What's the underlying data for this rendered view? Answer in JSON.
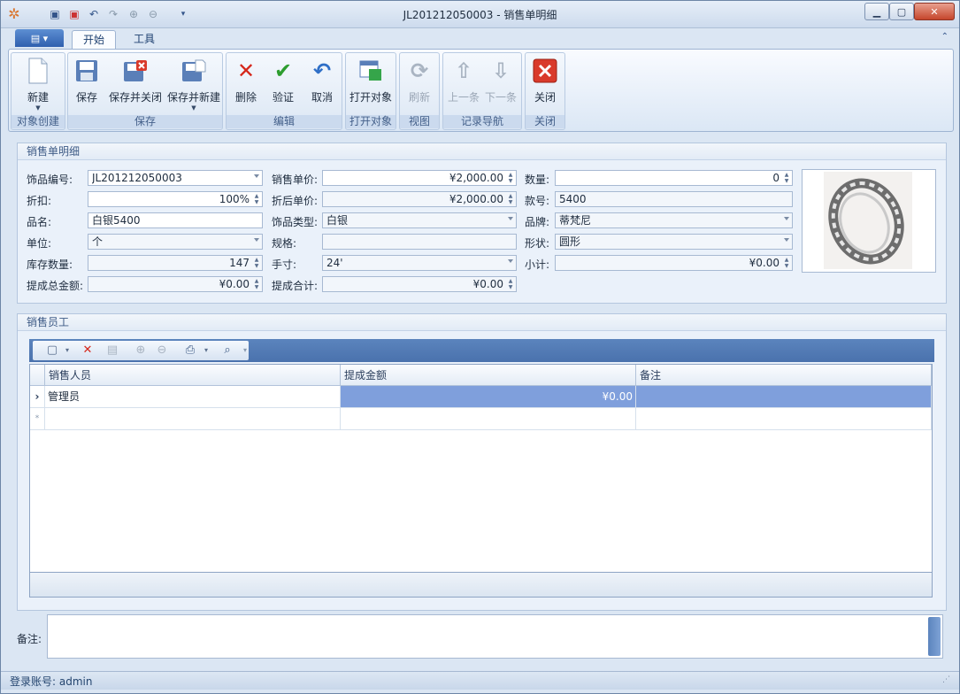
{
  "window": {
    "title": "JL201212050003 - 销售单明细",
    "buttons": {
      "minimize": "▁",
      "maximize": "▢",
      "close": "✕"
    }
  },
  "ribbon": {
    "collapse_glyph": "⌃",
    "tabs": [
      {
        "label": "开始"
      },
      {
        "label": "工具"
      }
    ],
    "groups": [
      {
        "label": "对象创建",
        "buttons": [
          {
            "label": "新建",
            "icon": "new-document-icon"
          }
        ]
      },
      {
        "label": "保存",
        "buttons": [
          {
            "label": "保存",
            "icon": "save-icon"
          },
          {
            "label": "保存并关闭",
            "icon": "save-close-icon"
          },
          {
            "label": "保存并新建",
            "icon": "save-new-icon"
          }
        ]
      },
      {
        "label": "编辑",
        "buttons": [
          {
            "label": "删除",
            "icon": "delete-icon"
          },
          {
            "label": "验证",
            "icon": "validate-check-icon"
          },
          {
            "label": "取消",
            "icon": "undo-icon"
          }
        ]
      },
      {
        "label": "打开对象",
        "buttons": [
          {
            "label": "打开对象",
            "icon": "open-object-icon"
          }
        ]
      },
      {
        "label": "视图",
        "buttons": [
          {
            "label": "刷新",
            "icon": "refresh-icon"
          }
        ]
      },
      {
        "label": "记录导航",
        "buttons": [
          {
            "label": "上一条",
            "icon": "arrow-up-icon"
          },
          {
            "label": "下一条",
            "icon": "arrow-down-icon"
          }
        ]
      },
      {
        "label": "关闭",
        "buttons": [
          {
            "label": "关闭",
            "icon": "close-red-icon"
          }
        ]
      }
    ]
  },
  "detail": {
    "section_title": "销售单明细",
    "fields": {
      "item_code": {
        "label": "饰品编号:",
        "value": "JL201212050003"
      },
      "discount": {
        "label": "折扣:",
        "value": "100%"
      },
      "product_name": {
        "label": "品名:",
        "value": "白银5400"
      },
      "unit": {
        "label": "单位:",
        "value": "个"
      },
      "stock_qty": {
        "label": "库存数量:",
        "value": "147"
      },
      "commission_total": {
        "label": "提成总金额:",
        "value": "¥0.00"
      },
      "unit_price": {
        "label": "销售单价:",
        "value": "¥2,000.00"
      },
      "discounted_price": {
        "label": "折后单价:",
        "value": "¥2,000.00"
      },
      "item_type": {
        "label": "饰品类型:",
        "value": "白银"
      },
      "spec": {
        "label": "规格:",
        "value": ""
      },
      "hand_size": {
        "label": "手寸:",
        "value": "24'"
      },
      "commission_sum": {
        "label": "提成合计:",
        "value": "¥0.00"
      },
      "quantity": {
        "label": "数量:",
        "value": "0"
      },
      "style_no": {
        "label": "款号:",
        "value": "5400"
      },
      "brand": {
        "label": "品牌:",
        "value": "蒂梵尼"
      },
      "shape": {
        "label": "形状:",
        "value": "圆形"
      },
      "subtotal": {
        "label": "小计:",
        "value": "¥0.00"
      }
    }
  },
  "staff": {
    "section_title": "销售员工",
    "columns": [
      "销售人员",
      "提成金额",
      "备注"
    ],
    "rows": [
      {
        "salesperson": "管理员",
        "commission": "¥0.00",
        "note": ""
      }
    ],
    "row_indicator": "›",
    "new_row_indicator": "*"
  },
  "memo": {
    "label": "备注:",
    "value": ""
  },
  "status": {
    "text": "登录账号: admin"
  }
}
